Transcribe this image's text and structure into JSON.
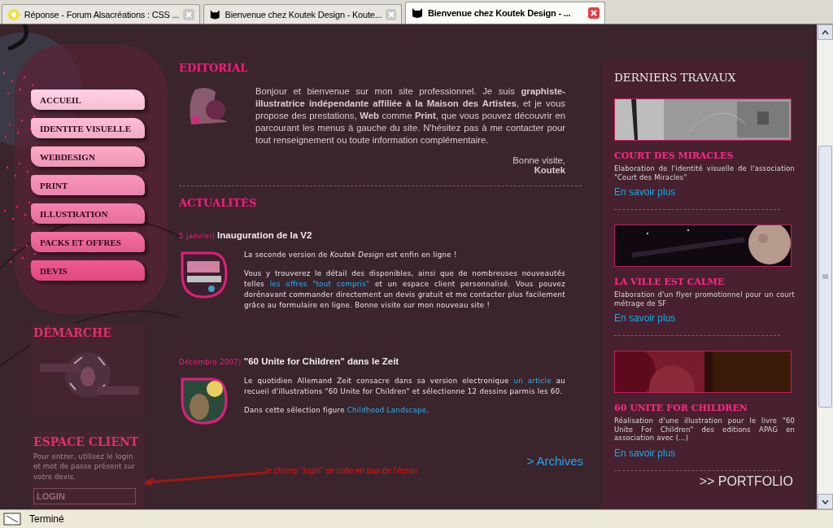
{
  "tabs": [
    {
      "label": "Réponse - Forum Alsacréations : CSS ...",
      "selected": false
    },
    {
      "label": "Bienvenue chez Koutek Design - Koute...",
      "selected": false
    },
    {
      "label": "Bienvenue chez Koutek Design - ...",
      "selected": true
    }
  ],
  "nav": [
    {
      "label": "ACCUEIL"
    },
    {
      "label": "IDENTITE VISUELLE"
    },
    {
      "label": "WEBDESIGN"
    },
    {
      "label": "PRINT"
    },
    {
      "label": "ILLUSTRATION"
    },
    {
      "label": "PACKS ET OFFRES"
    },
    {
      "label": "DEVIS"
    }
  ],
  "demarche": {
    "title": "DÉMARCHE"
  },
  "espace_client": {
    "title": "ESPACE CLIENT",
    "text": "Pour entrer, utilisez le login et mot de passe présent sur votre devis.",
    "login": {
      "value": "LOGIN"
    }
  },
  "editorial": {
    "title": "EDITORIAL",
    "text": "Bonjour et bienvenue sur mon site professionnel. Je suis **graphiste-illustratrice indépendante affiliée à la Maison des Artistes**, et je vous propose des prestations, **Web** comme **Print**, que vous pouvez découvrir en parcourant les menus à gauche du site. N'hésitez pas à me contacter pour tout renseignement ou toute information complémentaire.",
    "greeting": "Bonne visite,",
    "signature": "Koutek"
  },
  "actualites": {
    "title": "ACTUALITÉS",
    "items": [
      {
        "date": "5 janvier|",
        "title": "Inauguration de la V2",
        "paragraphs": [
          [
            {
              "kind": "text",
              "text": "La seconde version de "
            },
            {
              "kind": "italic",
              "text": "Koutek Design"
            },
            {
              "kind": "text",
              "text": " est enfin en ligne !"
            }
          ],
          [
            {
              "kind": "text",
              "text": "Vous y trouverez le détail des disponibles, ainsi que de nombreuses nouveautés telles "
            },
            {
              "kind": "link",
              "text": "les offres \"tout compris\""
            },
            {
              "kind": "text",
              "text": " et un espace client personnalisé. Vous pouvez dorénavant commander directement un devis gratuit et me contacter plus facilement grâce au formulaire en ligne. Bonne visite sur mon nouveau site !"
            }
          ]
        ]
      },
      {
        "date": "Décembre 2007|",
        "title": "\"60 Unite for Children\" dans le Zeit",
        "paragraphs": [
          [
            {
              "kind": "text",
              "text": "Le quotidien Allemand Zeit consacre dans sa version electronique "
            },
            {
              "kind": "link",
              "text": "un article"
            },
            {
              "kind": "text",
              "text": " au recueil d'illustrations \"60 Unite for Children\" et sélectionne 12 dessins parmis les 60."
            }
          ],
          [
            {
              "kind": "text",
              "text": "Dans cette sélection figure "
            },
            {
              "kind": "link",
              "text": "Childhood Landscape"
            },
            {
              "kind": "text",
              "text": "."
            }
          ]
        ]
      }
    ],
    "archives": "> Archives"
  },
  "annotation": "le champ \"login\" se colle en bas de l'écran",
  "travaux": {
    "title": "DERNIERS TRAVAUX",
    "items": [
      {
        "title": "COURT DES MIRACLES",
        "text": "Elaboration de l'identité visuelle de l'association \"Court des Miracles\"",
        "more": "En savoir plus"
      },
      {
        "title": "LA VILLE EST CALME",
        "text": "Elaboration d'un flyer promotionnel pour un court métrage de SF",
        "more": "En savoir plus"
      },
      {
        "title": "60 UNITE FOR CHILDREN",
        "text": "Réalisation d'une illustration pour le livre \"60 Unite For Children\" des editions APAG en association avec (...)",
        "more": "En savoir plus"
      }
    ],
    "portfolio": ">> PORTFOLIO"
  },
  "status": "Terminé"
}
